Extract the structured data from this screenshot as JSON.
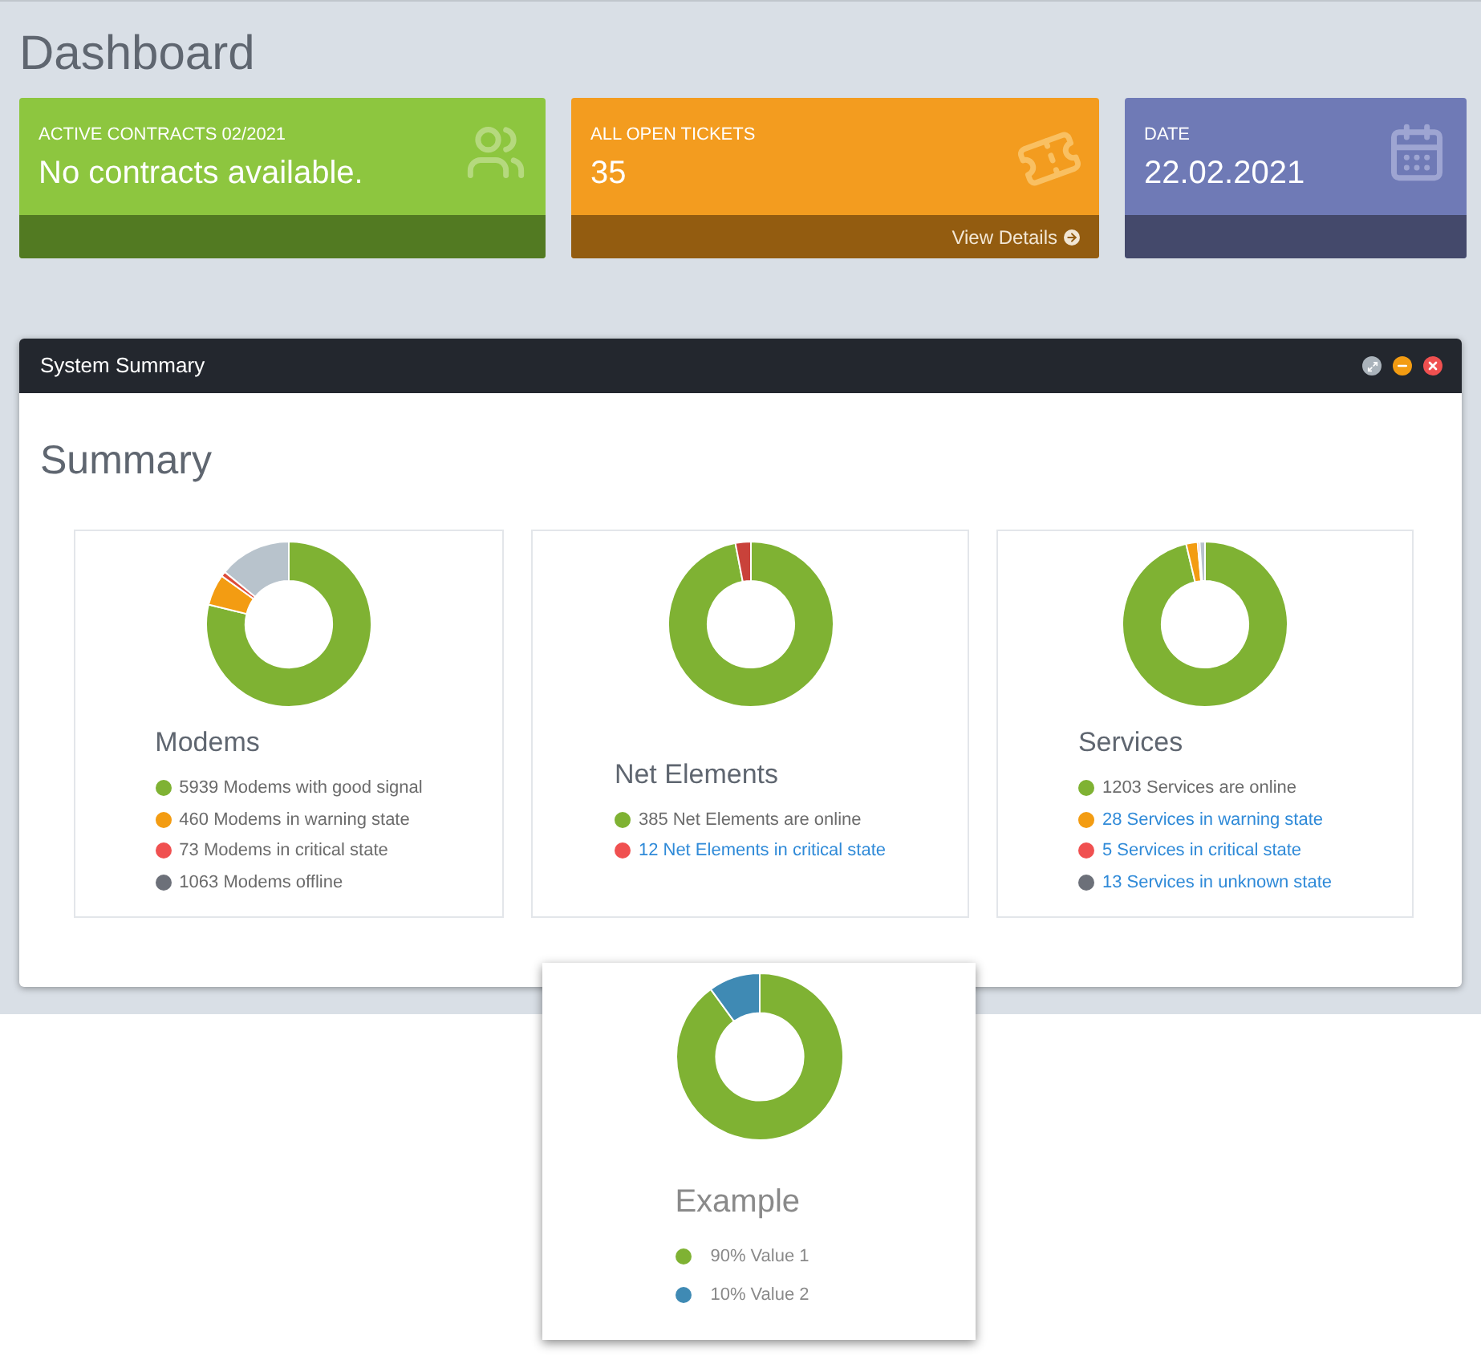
{
  "page_title": "Dashboard",
  "cards": [
    {
      "kind": "contracts",
      "label": "ACTIVE CONTRACTS 02/2021",
      "value": "No contracts available.",
      "color": "#8dc63f"
    },
    {
      "kind": "tickets",
      "label": "ALL OPEN TICKETS",
      "value": "35",
      "footer_link": "View Details",
      "color": "#f39c1f"
    },
    {
      "kind": "date",
      "label": "DATE",
      "value": "22.02.2021",
      "color": "#6f7ab6"
    }
  ],
  "panel": {
    "title": "System Summary",
    "heading": "Summary",
    "boxes": [
      {
        "title": "Modems",
        "chart_data": {
          "type": "donut",
          "categories": [
            "5939 Modems with good signal",
            "460 Modems in warning state",
            "73 Modems in critical state",
            "1063 Modems offline"
          ],
          "values": [
            5939,
            460,
            73,
            1063
          ],
          "colors": [
            "#7fb233",
            "#f39c12",
            "#dd4b39",
            "#b8c3cc"
          ]
        },
        "legend": [
          {
            "color": "#7fb233",
            "link": false
          },
          {
            "color": "#f39c12",
            "link": false
          },
          {
            "color": "#f05050",
            "link": false
          },
          {
            "color": "#6c7079",
            "link": false
          }
        ]
      },
      {
        "title": "Net Elements",
        "chart_data": {
          "type": "donut",
          "categories": [
            "385 Net Elements are online",
            "12 Net Elements in critical state"
          ],
          "values": [
            385,
            12
          ],
          "colors": [
            "#7fb233",
            "#c9423a"
          ]
        },
        "legend": [
          {
            "color": "#7fb233",
            "link": false
          },
          {
            "color": "#f05050",
            "link": true
          }
        ]
      },
      {
        "title": "Services",
        "chart_data": {
          "type": "donut",
          "categories": [
            "1203 Services are online",
            "28 Services in warning state",
            "5 Services in critical state",
            "13 Services in unknown state"
          ],
          "values": [
            1203,
            28,
            5,
            13
          ],
          "colors": [
            "#7fb233",
            "#f39c12",
            "#dd4b39",
            "#b8c3cc"
          ]
        },
        "legend": [
          {
            "color": "#7fb233",
            "link": false
          },
          {
            "color": "#f39c12",
            "link": true
          },
          {
            "color": "#f05050",
            "link": true
          },
          {
            "color": "#6c7079",
            "link": true
          }
        ]
      }
    ]
  },
  "example": {
    "title": "Example",
    "chart_data": {
      "type": "donut",
      "categories": [
        "90% Value 1",
        "10% Value 2"
      ],
      "values": [
        90,
        10
      ],
      "colors": [
        "#7fb233",
        "#3f8ab4"
      ]
    },
    "legend": [
      {
        "color": "#7fb233",
        "link": false
      },
      {
        "color": "#3f8ab4",
        "link": false
      }
    ]
  }
}
